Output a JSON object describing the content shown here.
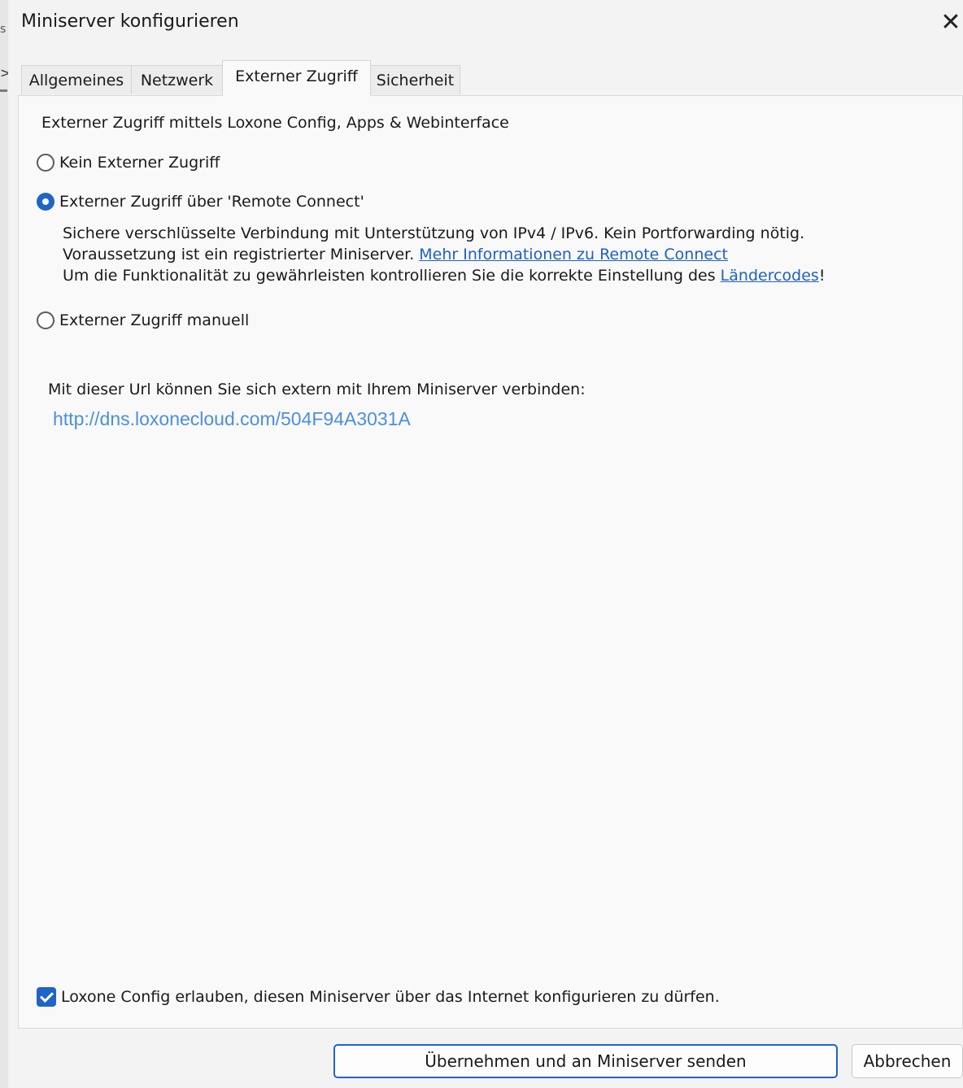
{
  "window": {
    "title": "Miniserver konfigurieren",
    "close_glyph": "✕"
  },
  "background_fragments": {
    "text_s": "s",
    "arrow": ">"
  },
  "tabs": [
    {
      "label": "Allgemeines",
      "active": false
    },
    {
      "label": "Netzwerk",
      "active": false
    },
    {
      "label": "Externer Zugriff",
      "active": true
    },
    {
      "label": "Sicherheit",
      "active": false
    }
  ],
  "external_access": {
    "heading": "Externer Zugriff mittels Loxone Config, Apps & Webinterface",
    "options": [
      {
        "label": "Kein Externer Zugriff",
        "selected": false
      },
      {
        "label": "Externer Zugriff über 'Remote Connect'",
        "selected": true
      },
      {
        "label": "Externer Zugriff manuell",
        "selected": false
      }
    ],
    "description": {
      "line1": "Sichere verschlüsselte Verbindung mit Unterstützung von IPv4 / IPv6. Kein Portforwarding nötig.",
      "line2_text": "Voraussetzung ist ein registrierter Miniserver. ",
      "line2_link": "Mehr Informationen zu Remote Connect",
      "line3_text": "Um die Funktionalität zu gewährleisten kontrollieren Sie die korrekte Einstellung des ",
      "line3_link": "Ländercodes",
      "line3_suffix": "!"
    },
    "url_label": "Mit dieser Url können Sie sich extern mit Ihrem Miniserver verbinden:",
    "url": "http://dns.loxonecloud.com/504F94A3031A"
  },
  "allow_config": {
    "label": "Loxone Config erlauben, diesen Miniserver über das Internet konfigurieren zu dürfen.",
    "checked": true
  },
  "buttons": {
    "apply": "Übernehmen und an Miniserver senden",
    "cancel": "Abbrechen"
  },
  "colors": {
    "accent": "#1f64c8",
    "link": "#1f5fc6",
    "url_link": "#4a8fe0"
  }
}
